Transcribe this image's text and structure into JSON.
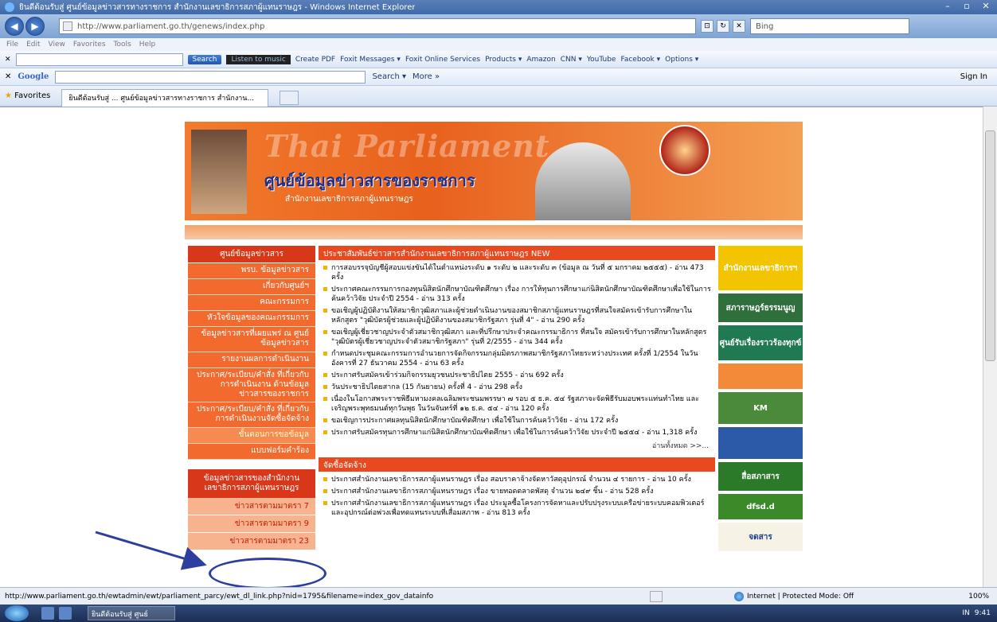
{
  "window": {
    "title": "ยินดีต้อนรับสู่ ศูนย์ข้อมูลข่าวสารทางราชการ สำนักงานเลขาธิการสภาผู้แทนราษฎร - Windows Internet Explorer",
    "minimize": "–",
    "maximize": "▫",
    "close": "✕"
  },
  "addressbar": {
    "url": "http://www.parliament.go.th/genews/index.php",
    "search_provider": "Bing",
    "back": "◀",
    "forward": "▶",
    "refresh": "↻",
    "stop": "✕",
    "compat": "⊡"
  },
  "menu": [
    "File",
    "Edit",
    "View",
    "Favorites",
    "Tools",
    "Help"
  ],
  "toolbar1": {
    "search_label": "Search",
    "music_label": "Listen to music",
    "items": [
      "Create PDF",
      "Foxit Messages ▾",
      "Foxit Online Services",
      "Products ▾",
      "Amazon",
      "CNN ▾",
      "YouTube",
      "Facebook ▾",
      "Options ▾"
    ]
  },
  "toolbar2": {
    "logo": "Google",
    "search_label": "Search ▾",
    "more_label": "More »",
    "sign_in": "Sign In"
  },
  "favorites": {
    "label": "Favorites",
    "tab_title": "ยินดีต้อนรับสู่ ... ศูนย์ข้อมูลข่าวสารทางราชการ สำนักงาน..."
  },
  "site": {
    "banner_watermark": "Thai Parliament",
    "banner_title": "ศูนย์ข้อมูลข่าวสารของราชการ",
    "banner_subtitle": "สำนักงานเลขาธิการสภาผู้แทนราษฎร",
    "left_menu_header": "ศูนย์ข้อมูลข่าวสาร",
    "left_menu": [
      "พรบ. ข้อมูลข่าวสาร",
      "เกี่ยวกับศูนย์ฯ",
      "คณะกรรมการ",
      "หัวใจข้อมูลของคณะกรรมการ",
      "ข้อมูลข่าวสารที่เผยแพร่ ณ ศูนย์ข้อมูลข่าวสาร",
      "รายงานผลการดำเนินงาน",
      "ประกาศ/ระเบียบ/คำสั่ง ที่เกี่ยวกับการดำเนินงาน ด้านข้อมูลข่าวสารของราชการ",
      "ประกาศ/ระเบียบ/คำสั่ง ที่เกี่ยวกับการดำเนินงานจัดซื้อจัดจ้าง",
      "ขั้นตอนการขอข้อมูล",
      "แบบฟอร์มคำร้อง"
    ],
    "left_menu2_header": "ข้อมูลข่าวสารของสำนักงาน เลขาธิการสภาผู้แทนราษฎร",
    "left_menu2": [
      "ข่าวสารตามมาตรา 7",
      "ข่าวสารตามมาตรา 9",
      "ข่าวสารตามมาตรา 23"
    ],
    "news_header": "ประชาสัมพันธ์ข่าวสารสำนักงานเลขาธิการสภาผู้แทนราษฎร NEW",
    "news": [
      "การสอบรรจุบัญชีผู้สอบแข่งขันได้ในตำแหน่งระดับ ๑ ระดับ ๒ และระดับ ๓ (ข้อมูล ณ วันที่ ๕ มกราคม ๒๕๕๕) - อ่าน 473 ครั้ง",
      "ประกาศคณะกรรมการกองทุนนิสิตนักศึกษาบัณฑิตศึกษา เรื่อง การให้ทุนการศึกษาแก่นิสิตนักศึกษาบัณฑิตศึกษาเพื่อใช้ในการค้นคว้าวิจัย ประจำปี 2554 - อ่าน 313 ครั้ง",
      "ขอเชิญผู้ปฏิบัติงานให้สมาชิกวุฒิสภาและผู้ช่วยดำเนินงานของสมาชิกสภาผู้แทนราษฎรที่สนใจสมัครเข้ารับการศึกษาในหลักสูตร \"วุฒิบัตรผู้ช่วยและผู้ปฏิบัติงานของสมาชิกรัฐสภา รุ่นที่ 4\" - อ่าน 290 ครั้ง",
      "ขอเชิญผู้เชี่ยวชาญประจำตัวสมาชิกวุฒิสภา และที่ปรึกษาประจำคณะกรรมาธิการ ที่สนใจ สมัครเข้ารับการศึกษาในหลักสูตร \"วุฒิบัตรผู้เชี่ยวชาญประจำตัวสมาชิกรัฐสภา\" รุ่นที่ 2/2555 - อ่าน 344 ครั้ง",
      "กำหนดประชุมคณะกรรมการอำนวยการจัดกิจกรรมกลุ่มมิตรภาพสมาชิกรัฐสภาไทยระหว่างประเทศ ครั้งที่ 1/2554 ในวันอังคารที่ 27 ธันวาคม 2554 - อ่าน 63 ครั้ง",
      "ประกาศรับสมัครเข้าร่วมกิจกรรมยุวชนประชาธิปไตย 2555 - อ่าน 692 ครั้ง",
      "วันประชาธิปไตยสากล (15 กันยายน) ครั้งที่ 4 - อ่าน 298 ครั้ง",
      "เนื่องในโอกาสพระราชพิธีมหามงคลเฉลิมพระชนมพรรษา ๗ รอบ ๕ ธ.ค. ๕๔ รัฐสภาจะจัดพิธีรับมอบพระแท่นทำไทย และเจริญพระพุทธมนต์ทุกวันพุธ ในวันจันทร์ที่ ๑๒ ธ.ค. ๕๔ - อ่าน 120 ครั้ง",
      "ขอเชิญการประกาศผลทุนนิสิตนักศึกษาบัณฑิตศึกษา เพื่อใช้ในการค้นคว้าวิจัย - อ่าน 172 ครั้ง",
      "ประกาศรับสมัครทุนการศึกษาแก่นิสิตนักศึกษาบัณฑิตศึกษา เพื่อใช้ในการค้นคว้าวิจัย ประจำปี ๒๕๕๔ - อ่าน 1,318 ครั้ง"
    ],
    "read_all": "อ่านทั้งหมด >>...",
    "procure_header": "จัดซื้อจัดจ้าง",
    "procure": [
      "ประกาศสำนักงานเลขาธิการสภาผู้แทนราษฎร เรื่อง สอบราคาจ้างจัดหาวัสดุอุปกรณ์ จำนวน ๔ รายการ - อ่าน 10 ครั้ง",
      "ประกาศสำนักงานเลขาธิการสภาผู้แทนราษฎร เรื่อง ขายทอดตลาดพัสดุ จำนวน ๒๔๙ ชิ้น - อ่าน 528 ครั้ง",
      "ประกาศสำนักงานเลขาธิการสภาผู้แทนราษฎร เรื่อง ประมูลซื้อโครงการจัดหาและปรับปรุงระบบเครือข่ายระบบคอมพิวเตอร์และอุปกรณ์ต่อพ่วงเพื่อทดแทนระบบที่เสื่อมสภาพ - อ่าน 813 ครั้ง"
    ],
    "right_banners": [
      {
        "label": "สำนักงานเลขาธิการฯ",
        "color": "#f2c500"
      },
      {
        "label": "สภาราษฎร์ธรรมนูญ",
        "color": "#2e6f3b"
      },
      {
        "label": "ศูนย์รับเรื่องราวร้องทุกข์",
        "color": "#1f7a52"
      },
      {
        "label": "",
        "color": "#f28a3a"
      },
      {
        "label": "KM",
        "color": "#4a8a3a"
      },
      {
        "label": "",
        "color": "#2c5aa8"
      },
      {
        "label": "สื่อสภาสาร",
        "color": "#2a7a2a"
      },
      {
        "label": "dfsd.d",
        "color": "#3a8a2a"
      },
      {
        "label": "จดสาร",
        "color": "#f7f2e6"
      }
    ]
  },
  "status": {
    "url": "http://www.parliament.go.th/ewtadmin/ewt/parliament_parcy/ewt_dl_link.php?nid=1795&filename=index_gov_datainfo",
    "zone": "Internet | Protected Mode: Off",
    "zoom": "100%"
  },
  "taskbar": {
    "task_label": "ยินดีต้อนรับสู่ ศูนย์",
    "lang": "IN",
    "clock": "9:41"
  }
}
